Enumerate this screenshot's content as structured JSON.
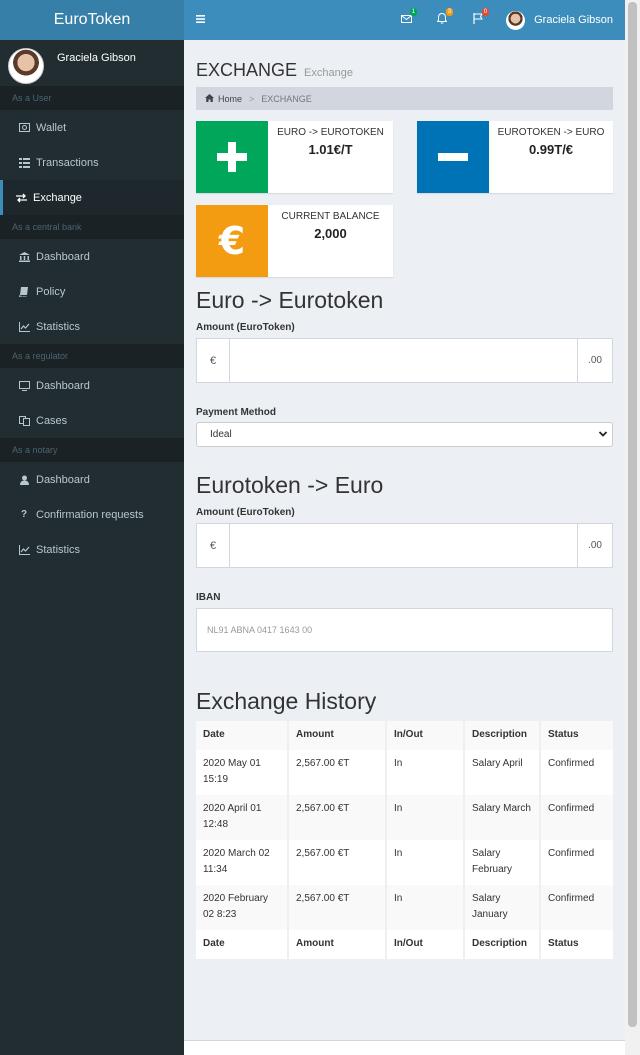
{
  "app": {
    "logo": "EuroToken"
  },
  "user": {
    "name": "Graciela Gibson"
  },
  "header": {
    "menu_icon": "bars-icon",
    "notifications": [
      {
        "icon": "envelope-icon",
        "count": "1",
        "color": "#00a65a"
      },
      {
        "icon": "bell-icon",
        "count": "3",
        "color": "#f39c12"
      },
      {
        "icon": "flag-icon",
        "count": "0",
        "color": "#dd4b39"
      }
    ],
    "user_name": "Graciela Gibson"
  },
  "sidebar": {
    "sections": [
      {
        "header": "As a User",
        "items": [
          {
            "label": "Wallet",
            "icon": "money-icon",
            "active": false
          },
          {
            "label": "Transactions",
            "icon": "list-icon",
            "active": false
          },
          {
            "label": "Exchange",
            "icon": "exchange-icon",
            "active": true
          }
        ]
      },
      {
        "header": "As a central bank",
        "items": [
          {
            "label": "Dashboard",
            "icon": "bank-icon",
            "active": false
          },
          {
            "label": "Policy",
            "icon": "book-icon",
            "active": false
          },
          {
            "label": "Statistics",
            "icon": "line-chart-icon",
            "active": false
          }
        ]
      },
      {
        "header": "As a regulator",
        "items": [
          {
            "label": "Dashboard",
            "icon": "desktop-icon",
            "active": false
          },
          {
            "label": "Cases",
            "icon": "copy-icon",
            "active": false
          }
        ]
      },
      {
        "header": "As a notary",
        "items": [
          {
            "label": "Dashboard",
            "icon": "user-icon",
            "active": false
          },
          {
            "label": "Confirmation requests",
            "icon": "question-icon",
            "active": false
          },
          {
            "label": "Statistics",
            "icon": "line-chart-icon",
            "active": false
          }
        ]
      }
    ]
  },
  "page": {
    "title": "EXCHANGE",
    "subtitle": "Exchange",
    "breadcrumb": {
      "home": "Home",
      "separator": ">",
      "current": "EXCHANGE"
    }
  },
  "info_boxes": {
    "buy": {
      "label": "EURO -> EUROTOKEN",
      "value": "1.01€/T",
      "color": "#00a65a",
      "icon": "plus-icon"
    },
    "sell": {
      "label": "EUROTOKEN -> EURO",
      "value": "0.99T/€",
      "color": "#0073b7",
      "icon": "minus-icon"
    },
    "balance": {
      "label": "CURRENT BALANCE",
      "value": "2,000",
      "color": "#f39c12",
      "icon": "euro-icon",
      "symbol": "€"
    }
  },
  "buy_form": {
    "heading": "Euro -> Eurotoken",
    "amount_label": "Amount (EuroToken)",
    "prefix": "€",
    "suffix": ".00",
    "payment_label": "Payment Method",
    "payment_value": "Ideal"
  },
  "sell_form": {
    "heading": "Eurotoken -> Euro",
    "amount_label": "Amount (EuroToken)",
    "prefix": "€",
    "suffix": ".00",
    "iban_label": "IBAN",
    "iban_placeholder": "NL91 ABNA 0417 1643 00"
  },
  "history": {
    "heading": "Exchange History",
    "columns": [
      "Date",
      "Amount",
      "In/Out",
      "Description",
      "Status"
    ],
    "rows": [
      [
        "2020 May 01 15:19",
        "2,567.00 €T",
        "In",
        "Salary April",
        "Confirmed"
      ],
      [
        "2020 April 01 12:48",
        "2,567.00 €T",
        "In",
        "Salary March",
        "Confirmed"
      ],
      [
        "2020 March 02 11:34",
        "2,567.00 €T",
        "In",
        "Salary February",
        "Confirmed"
      ],
      [
        "2020 February 02 8:23",
        "2,567.00 €T",
        "In",
        "Salary January",
        "Confirmed"
      ]
    ]
  }
}
